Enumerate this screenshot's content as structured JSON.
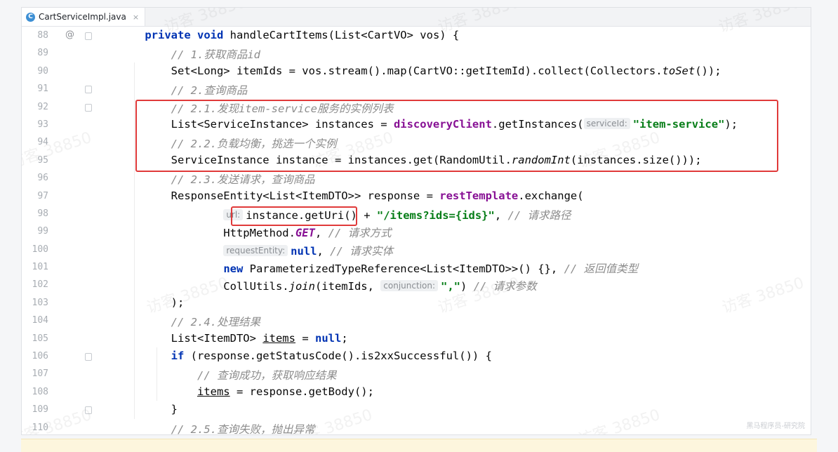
{
  "tab": {
    "icon_letter": "C",
    "filename": "CartServiceImpl.java",
    "close_glyph": "×"
  },
  "watermark": "访客 38850",
  "brand": "黑马程序员-研究院",
  "lines": [
    {
      "num": "88",
      "gutter": "@",
      "parts": [
        [
          "",
          "    "
        ],
        [
          "kw",
          "private void "
        ],
        [
          "",
          "handleCartItems(List<CartVO> vos) {"
        ]
      ]
    },
    {
      "num": "89",
      "parts": [
        [
          "",
          "        "
        ],
        [
          "cm",
          "// 1.获取商品id"
        ]
      ]
    },
    {
      "num": "90",
      "parts": [
        [
          "",
          "        Set<Long> itemIds = vos.stream().map(CartVO::getItemId).collect(Collectors."
        ],
        [
          "static",
          "toSet"
        ],
        [
          "",
          "());"
        ]
      ]
    },
    {
      "num": "91",
      "parts": [
        [
          "",
          "        "
        ],
        [
          "cm",
          "// 2.查询商品"
        ]
      ]
    },
    {
      "num": "92",
      "parts": [
        [
          "",
          "        "
        ],
        [
          "cm",
          "// 2.1.发现item-service服务的实例列表"
        ]
      ]
    },
    {
      "num": "93",
      "parts": [
        [
          "",
          "        List<ServiceInstance> instances = "
        ],
        [
          "field",
          "discoveryClient"
        ],
        [
          "",
          ".getInstances("
        ],
        [
          "hint",
          "serviceId:"
        ],
        [
          "str",
          "\"item-service\""
        ],
        [
          "",
          ");"
        ]
      ]
    },
    {
      "num": "94",
      "parts": [
        [
          "",
          "        "
        ],
        [
          "cm",
          "// 2.2.负载均衡，挑选一个实例"
        ]
      ]
    },
    {
      "num": "95",
      "parts": [
        [
          "",
          "        ServiceInstance instance = instances.get(RandomUtil."
        ],
        [
          "static",
          "randomInt"
        ],
        [
          "",
          "(instances.size()));"
        ]
      ]
    },
    {
      "num": "96",
      "parts": [
        [
          "",
          "        "
        ],
        [
          "cm",
          "// 2.3.发送请求，查询商品"
        ]
      ]
    },
    {
      "num": "97",
      "parts": [
        [
          "",
          "        ResponseEntity<List<ItemDTO>> response = "
        ],
        [
          "field",
          "restTemplate"
        ],
        [
          "",
          ".exchange("
        ]
      ]
    },
    {
      "num": "98",
      "parts": [
        [
          "",
          "                "
        ],
        [
          "hint",
          "url:"
        ],
        [
          "",
          "instance.getUri() + "
        ],
        [
          "str",
          "\"/items?ids={ids}\""
        ],
        [
          "",
          ", "
        ],
        [
          "cm",
          "// 请求路径"
        ]
      ]
    },
    {
      "num": "99",
      "parts": [
        [
          "",
          "                HttpMethod."
        ],
        [
          "const",
          "GET"
        ],
        [
          "",
          ", "
        ],
        [
          "cm",
          "// 请求方式"
        ]
      ]
    },
    {
      "num": "100",
      "parts": [
        [
          "",
          "                "
        ],
        [
          "hint",
          "requestEntity:"
        ],
        [
          "kw",
          "null"
        ],
        [
          "",
          ", "
        ],
        [
          "cm",
          "// 请求实体"
        ]
      ]
    },
    {
      "num": "101",
      "parts": [
        [
          "",
          "                "
        ],
        [
          "kw",
          "new "
        ],
        [
          "",
          "ParameterizedTypeReference<List<ItemDTO>>() {}, "
        ],
        [
          "cm",
          "// 返回值类型"
        ]
      ]
    },
    {
      "num": "102",
      "parts": [
        [
          "",
          "                CollUtils."
        ],
        [
          "static",
          "join"
        ],
        [
          "",
          "(itemIds, "
        ],
        [
          "hint",
          "conjunction:"
        ],
        [
          "str",
          "\",\""
        ],
        [
          "",
          ") "
        ],
        [
          "cm",
          "// 请求参数"
        ]
      ]
    },
    {
      "num": "103",
      "parts": [
        [
          "",
          "        );"
        ]
      ]
    },
    {
      "num": "104",
      "parts": [
        [
          "",
          "        "
        ],
        [
          "cm",
          "// 2.4.处理结果"
        ]
      ]
    },
    {
      "num": "105",
      "parts": [
        [
          "",
          "        List<ItemDTO> "
        ],
        [
          "ul",
          "items"
        ],
        [
          "",
          " = "
        ],
        [
          "kw",
          "null"
        ],
        [
          "",
          ";"
        ]
      ]
    },
    {
      "num": "106",
      "parts": [
        [
          "",
          "        "
        ],
        [
          "kw",
          "if "
        ],
        [
          "",
          "(response.getStatusCode().is2xxSuccessful()) {"
        ]
      ]
    },
    {
      "num": "107",
      "parts": [
        [
          "",
          "            "
        ],
        [
          "cm",
          "// 查询成功，获取响应结果"
        ]
      ]
    },
    {
      "num": "108",
      "parts": [
        [
          "",
          "            "
        ],
        [
          "ul",
          "items"
        ],
        [
          "",
          " = response.getBody();"
        ]
      ]
    },
    {
      "num": "109",
      "parts": [
        [
          "",
          "        }"
        ]
      ]
    },
    {
      "num": "110",
      "parts": [
        [
          "",
          "        "
        ],
        [
          "cm",
          "// 2.5.查询失败，抛出异常"
        ]
      ]
    }
  ]
}
